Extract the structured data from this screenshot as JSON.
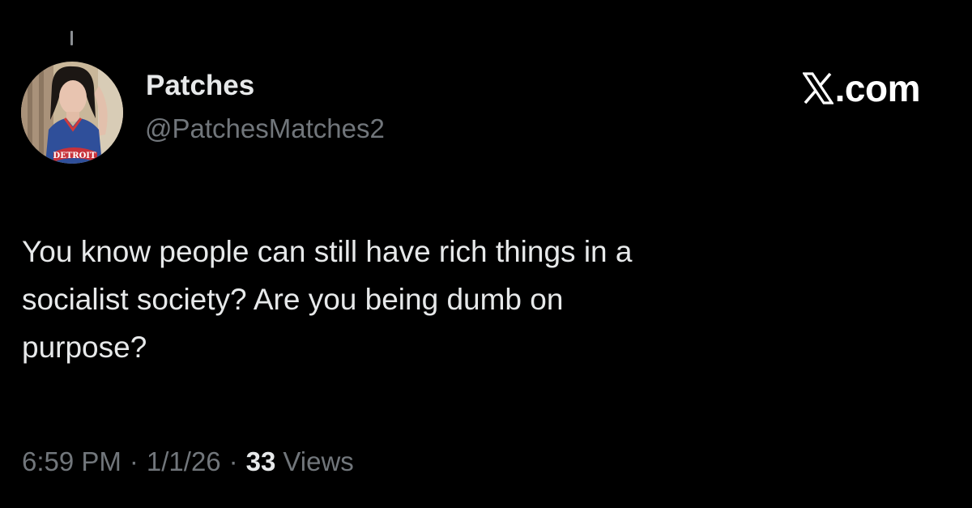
{
  "tweet": {
    "author": {
      "display_name": "Patches",
      "handle": "@PatchesMatches2",
      "avatar_jersey_text": "DETROIT"
    },
    "brand": {
      "icon": "x-logo-icon",
      "label": ".com"
    },
    "text_lines": [
      "You know people can still have rich things in a",
      "socialist society? Are you being dumb on",
      "purpose?"
    ],
    "meta": {
      "time": "6:59 PM",
      "separator": "·",
      "date": "1/1/26",
      "views_count": "33",
      "views_label": "Views"
    }
  },
  "colors": {
    "background": "#000000",
    "primary_text": "#e7e9ea",
    "secondary_text": "#71767b"
  }
}
